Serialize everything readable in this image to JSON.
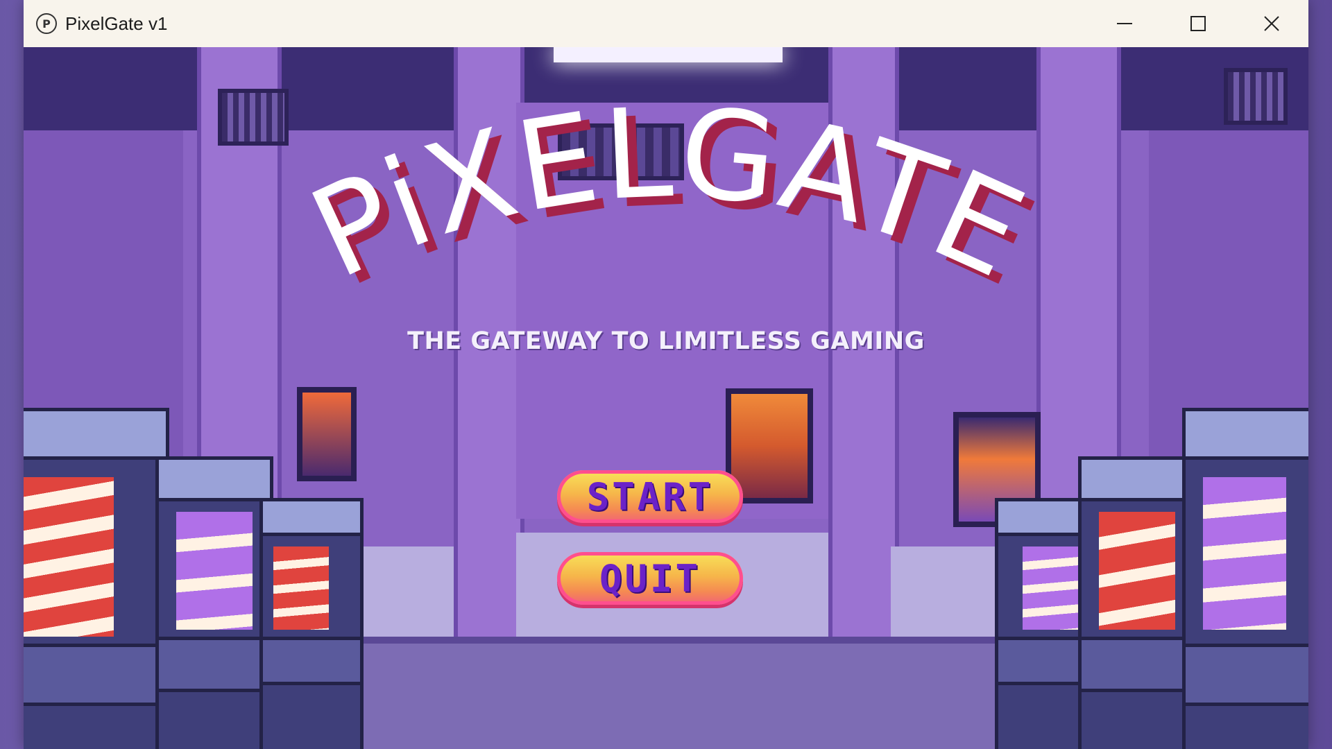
{
  "window": {
    "title": "PixelGate v1",
    "app_icon_letter": "P",
    "controls": [
      "minimize-icon",
      "maximize-icon",
      "close-icon"
    ]
  },
  "game": {
    "logo_text": "PiXELGATE",
    "tagline": "THE GATEWAY TO LIMITLESS GAMING",
    "menu": {
      "start_label": "START",
      "quit_label": "QUIT"
    }
  },
  "colors": {
    "logo_fill": "#ffffff",
    "logo_shadow": "#a3234a",
    "button_text": "#6b22c8",
    "button_outline": "#ff4f8e",
    "scene_wall": "#8a64c4"
  }
}
